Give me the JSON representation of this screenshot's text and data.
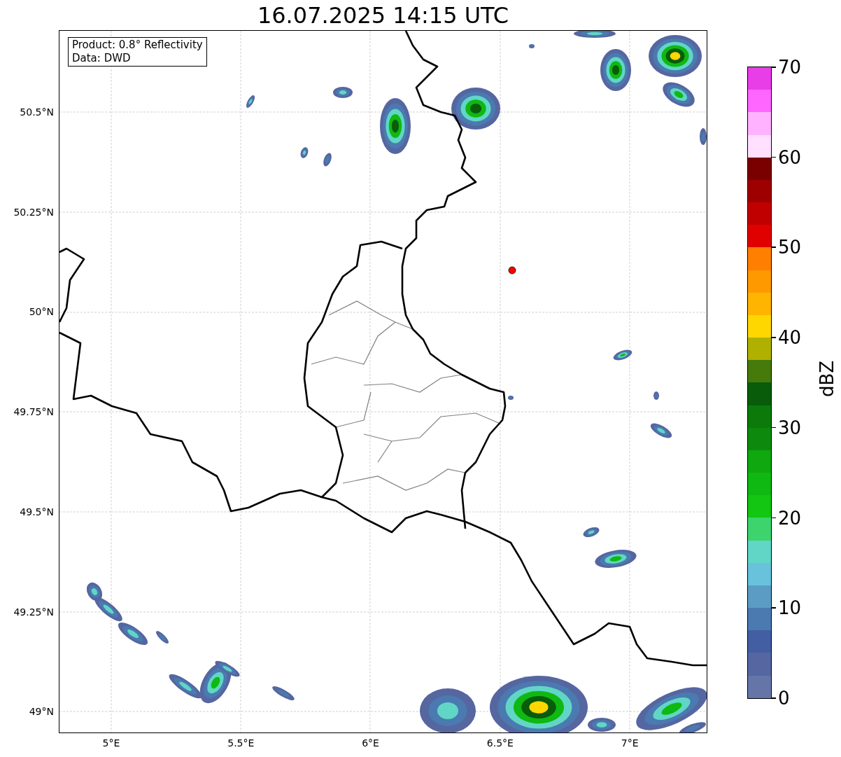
{
  "title": "16.07.2025 14:15 UTC",
  "info_box": [
    "Product: 0.8° Reflectivity",
    "Data: DWD"
  ],
  "y_ticks": [
    "50.5°N",
    "50.25°N",
    "50°N",
    "49.75°N",
    "49.5°N",
    "49.25°N",
    "49°N"
  ],
  "x_ticks": [
    "5°E",
    "5.5°E",
    "6°E",
    "6.5°E",
    "7°E"
  ],
  "colorbar": {
    "label": "dBZ",
    "ticks": [
      "70",
      "60",
      "50",
      "40",
      "30",
      "20",
      "10",
      "0"
    ],
    "bands": [
      {
        "color": "#6675a8"
      },
      {
        "color": "#5566a0"
      },
      {
        "color": "#435ea2"
      },
      {
        "color": "#4a7ab0"
      },
      {
        "color": "#5b9cc5"
      },
      {
        "color": "#68c2dc"
      },
      {
        "color": "#61d6c6"
      },
      {
        "color": "#3dd46e"
      },
      {
        "color": "#12c612"
      },
      {
        "color": "#10b812"
      },
      {
        "color": "#0fa80f"
      },
      {
        "color": "#0d8a0d"
      },
      {
        "color": "#0b7a0b"
      },
      {
        "color": "#085c0a"
      },
      {
        "color": "#467a0a"
      },
      {
        "color": "#b0b000"
      },
      {
        "color": "#ffd700"
      },
      {
        "color": "#ffb400"
      },
      {
        "color": "#ff9900"
      },
      {
        "color": "#ff7f00"
      },
      {
        "color": "#e00000"
      },
      {
        "color": "#c00000"
      },
      {
        "color": "#9e0000"
      },
      {
        "color": "#7a0000"
      },
      {
        "color": "#ffe0ff"
      },
      {
        "color": "#ffb3ff"
      },
      {
        "color": "#ff66ff"
      },
      {
        "color": "#e83ee8"
      }
    ]
  }
}
